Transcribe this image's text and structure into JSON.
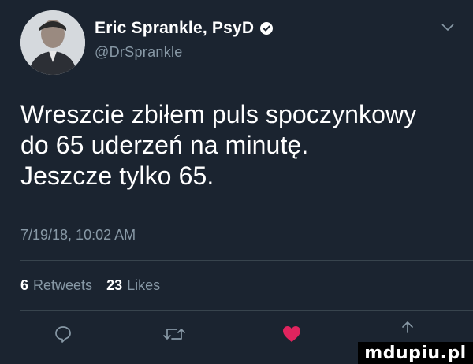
{
  "author": {
    "name": "Eric Sprankle, PsyD",
    "handle": "@DrSprankle",
    "verified_icon": "verified-badge-icon"
  },
  "tweet": {
    "lines": [
      "Wreszcie zbiłem puls spoczynkowy",
      "do 65 uderzeń na minutę.",
      "Jeszcze tylko 65."
    ],
    "timestamp": "7/19/18, 10:02 AM"
  },
  "stats": {
    "retweets_count": "6",
    "retweets_label": "Retweets",
    "likes_count": "23",
    "likes_label": "Likes"
  },
  "actions": {
    "reply_icon": "reply-icon",
    "retweet_icon": "retweet-icon",
    "like_icon": "heart-icon",
    "share_icon": "share-icon"
  },
  "watermark": {
    "text": "mdupiu.pl"
  },
  "colors": {
    "background": "#1b2430",
    "secondary_text": "#8899a6",
    "divider": "#38444d",
    "like": "#e0245e"
  }
}
